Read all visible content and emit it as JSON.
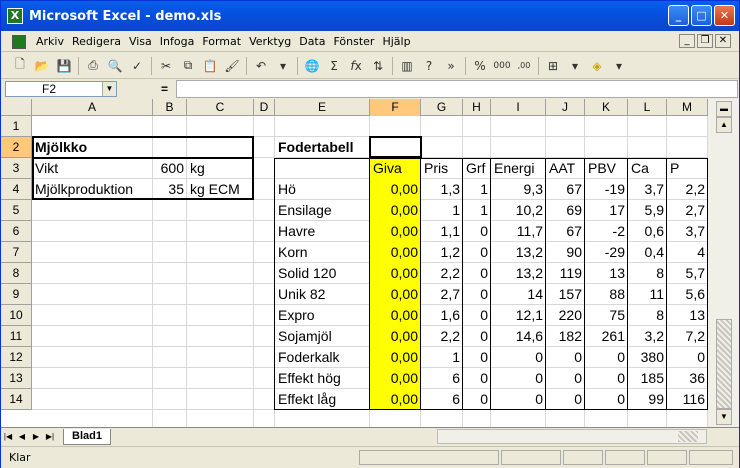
{
  "window": {
    "title": "Microsoft Excel - demo.xls",
    "app_icon": "excel-icon"
  },
  "menu": {
    "items": [
      "Arkiv",
      "Redigera",
      "Visa",
      "Infoga",
      "Format",
      "Verktyg",
      "Data",
      "Fönster",
      "Hjälp"
    ]
  },
  "formula_bar": {
    "name_box": "F2",
    "equals": "=",
    "formula": ""
  },
  "columns": [
    "A",
    "B",
    "C",
    "D",
    "E",
    "F",
    "G",
    "H",
    "I",
    "J",
    "K",
    "L",
    "M"
  ],
  "rows": [
    "1",
    "2",
    "3",
    "4",
    "5",
    "6",
    "7",
    "8",
    "9",
    "10",
    "11",
    "12",
    "13",
    "14"
  ],
  "selected_cell": "F2",
  "milk_table": {
    "title": "Mjölkko",
    "rows": [
      {
        "label": "Vikt",
        "value": "600",
        "unit": "kg"
      },
      {
        "label": "Mjölkproduktion",
        "value": "35",
        "unit": "kg ECM"
      }
    ]
  },
  "feed_table": {
    "title": "Fodertabell",
    "headers": [
      "Giva",
      "Pris",
      "Grf",
      "Energi",
      "AAT",
      "PBV",
      "Ca",
      "P"
    ],
    "rows": [
      {
        "name": "Hö",
        "values": [
          "0,00",
          "1,3",
          "1",
          "9,3",
          "67",
          "-19",
          "3,7",
          "2,2"
        ]
      },
      {
        "name": "Ensilage",
        "values": [
          "0,00",
          "1",
          "1",
          "10,2",
          "69",
          "17",
          "5,9",
          "2,7"
        ]
      },
      {
        "name": "Havre",
        "values": [
          "0,00",
          "1,1",
          "0",
          "11,7",
          "67",
          "-2",
          "0,6",
          "3,7"
        ]
      },
      {
        "name": "Korn",
        "values": [
          "0,00",
          "1,2",
          "0",
          "13,2",
          "90",
          "-29",
          "0,4",
          "4"
        ]
      },
      {
        "name": "Solid 120",
        "values": [
          "0,00",
          "2,2",
          "0",
          "13,2",
          "119",
          "13",
          "8",
          "5,7"
        ]
      },
      {
        "name": "Unik 82",
        "values": [
          "0,00",
          "2,7",
          "0",
          "14",
          "157",
          "88",
          "11",
          "5,6"
        ]
      },
      {
        "name": "Expro",
        "values": [
          "0,00",
          "1,6",
          "0",
          "12,1",
          "220",
          "75",
          "8",
          "13"
        ]
      },
      {
        "name": "Sojamjöl",
        "values": [
          "0,00",
          "2,2",
          "0",
          "14,6",
          "182",
          "261",
          "3,2",
          "7,2"
        ]
      },
      {
        "name": "Foderkalk",
        "values": [
          "0,00",
          "1",
          "0",
          "0",
          "0",
          "0",
          "380",
          "0"
        ]
      },
      {
        "name": "Effekt hög",
        "values": [
          "0,00",
          "6",
          "0",
          "0",
          "0",
          "0",
          "185",
          "36"
        ]
      },
      {
        "name": "Effekt låg",
        "values": [
          "0,00",
          "6",
          "0",
          "0",
          "0",
          "0",
          "99",
          "116"
        ]
      }
    ]
  },
  "sheet_tabs": [
    "Blad1"
  ],
  "status": {
    "text": "Klar"
  },
  "colors": {
    "highlight": "#ffff00",
    "selection_header": "#ffc87a",
    "titlebar": "#0551e0"
  }
}
